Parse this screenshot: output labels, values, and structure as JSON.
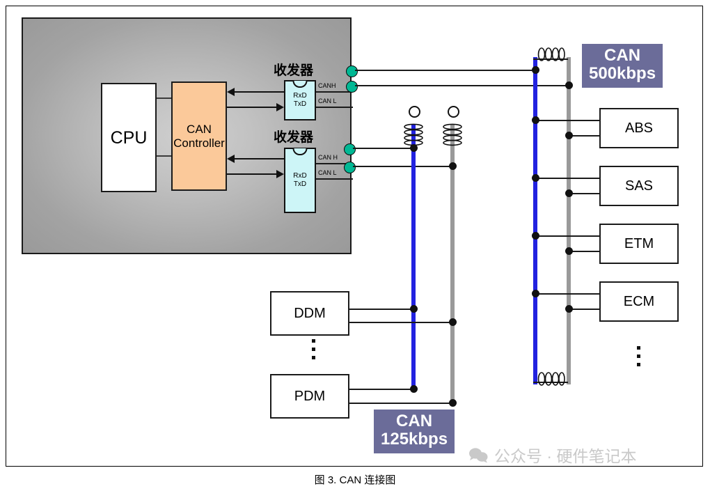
{
  "diagram": {
    "caption": "图 3.   CAN 连接图",
    "ecu": {
      "cpu_label": "CPU",
      "controller_label_line1": "CAN",
      "controller_label_line2": "Controller",
      "transceivers": [
        {
          "title": "收发器",
          "rxd": "RxD",
          "txd": "TxD",
          "can_high_label": "CANH",
          "can_low_label": "CAN L"
        },
        {
          "title": "收发器",
          "rxd": "RxD",
          "txd": "TxD",
          "can_high_label": "CAN H",
          "can_low_label": "CAN L"
        }
      ]
    },
    "bus_500": {
      "badge_line1": "CAN",
      "badge_line2": "500kbps",
      "nodes": [
        "ABS",
        "SAS",
        "ETM",
        "ECM"
      ],
      "more_indicator": "⋮"
    },
    "bus_125": {
      "badge_line1": "CAN",
      "badge_line2": "125kbps",
      "nodes": [
        "DDM",
        "PDM"
      ],
      "more_indicator": "⋮"
    },
    "colors": {
      "can_high_line": "#2222e0",
      "can_low_line": "#9a9a9a",
      "badge_bg": "#6b6c99",
      "controller_fill": "#fbc99a",
      "transceiver_fill": "#cdf5f7",
      "pin_dot": "#00b894"
    }
  },
  "watermark": {
    "text": "公众号 · 硬件笔记本"
  }
}
